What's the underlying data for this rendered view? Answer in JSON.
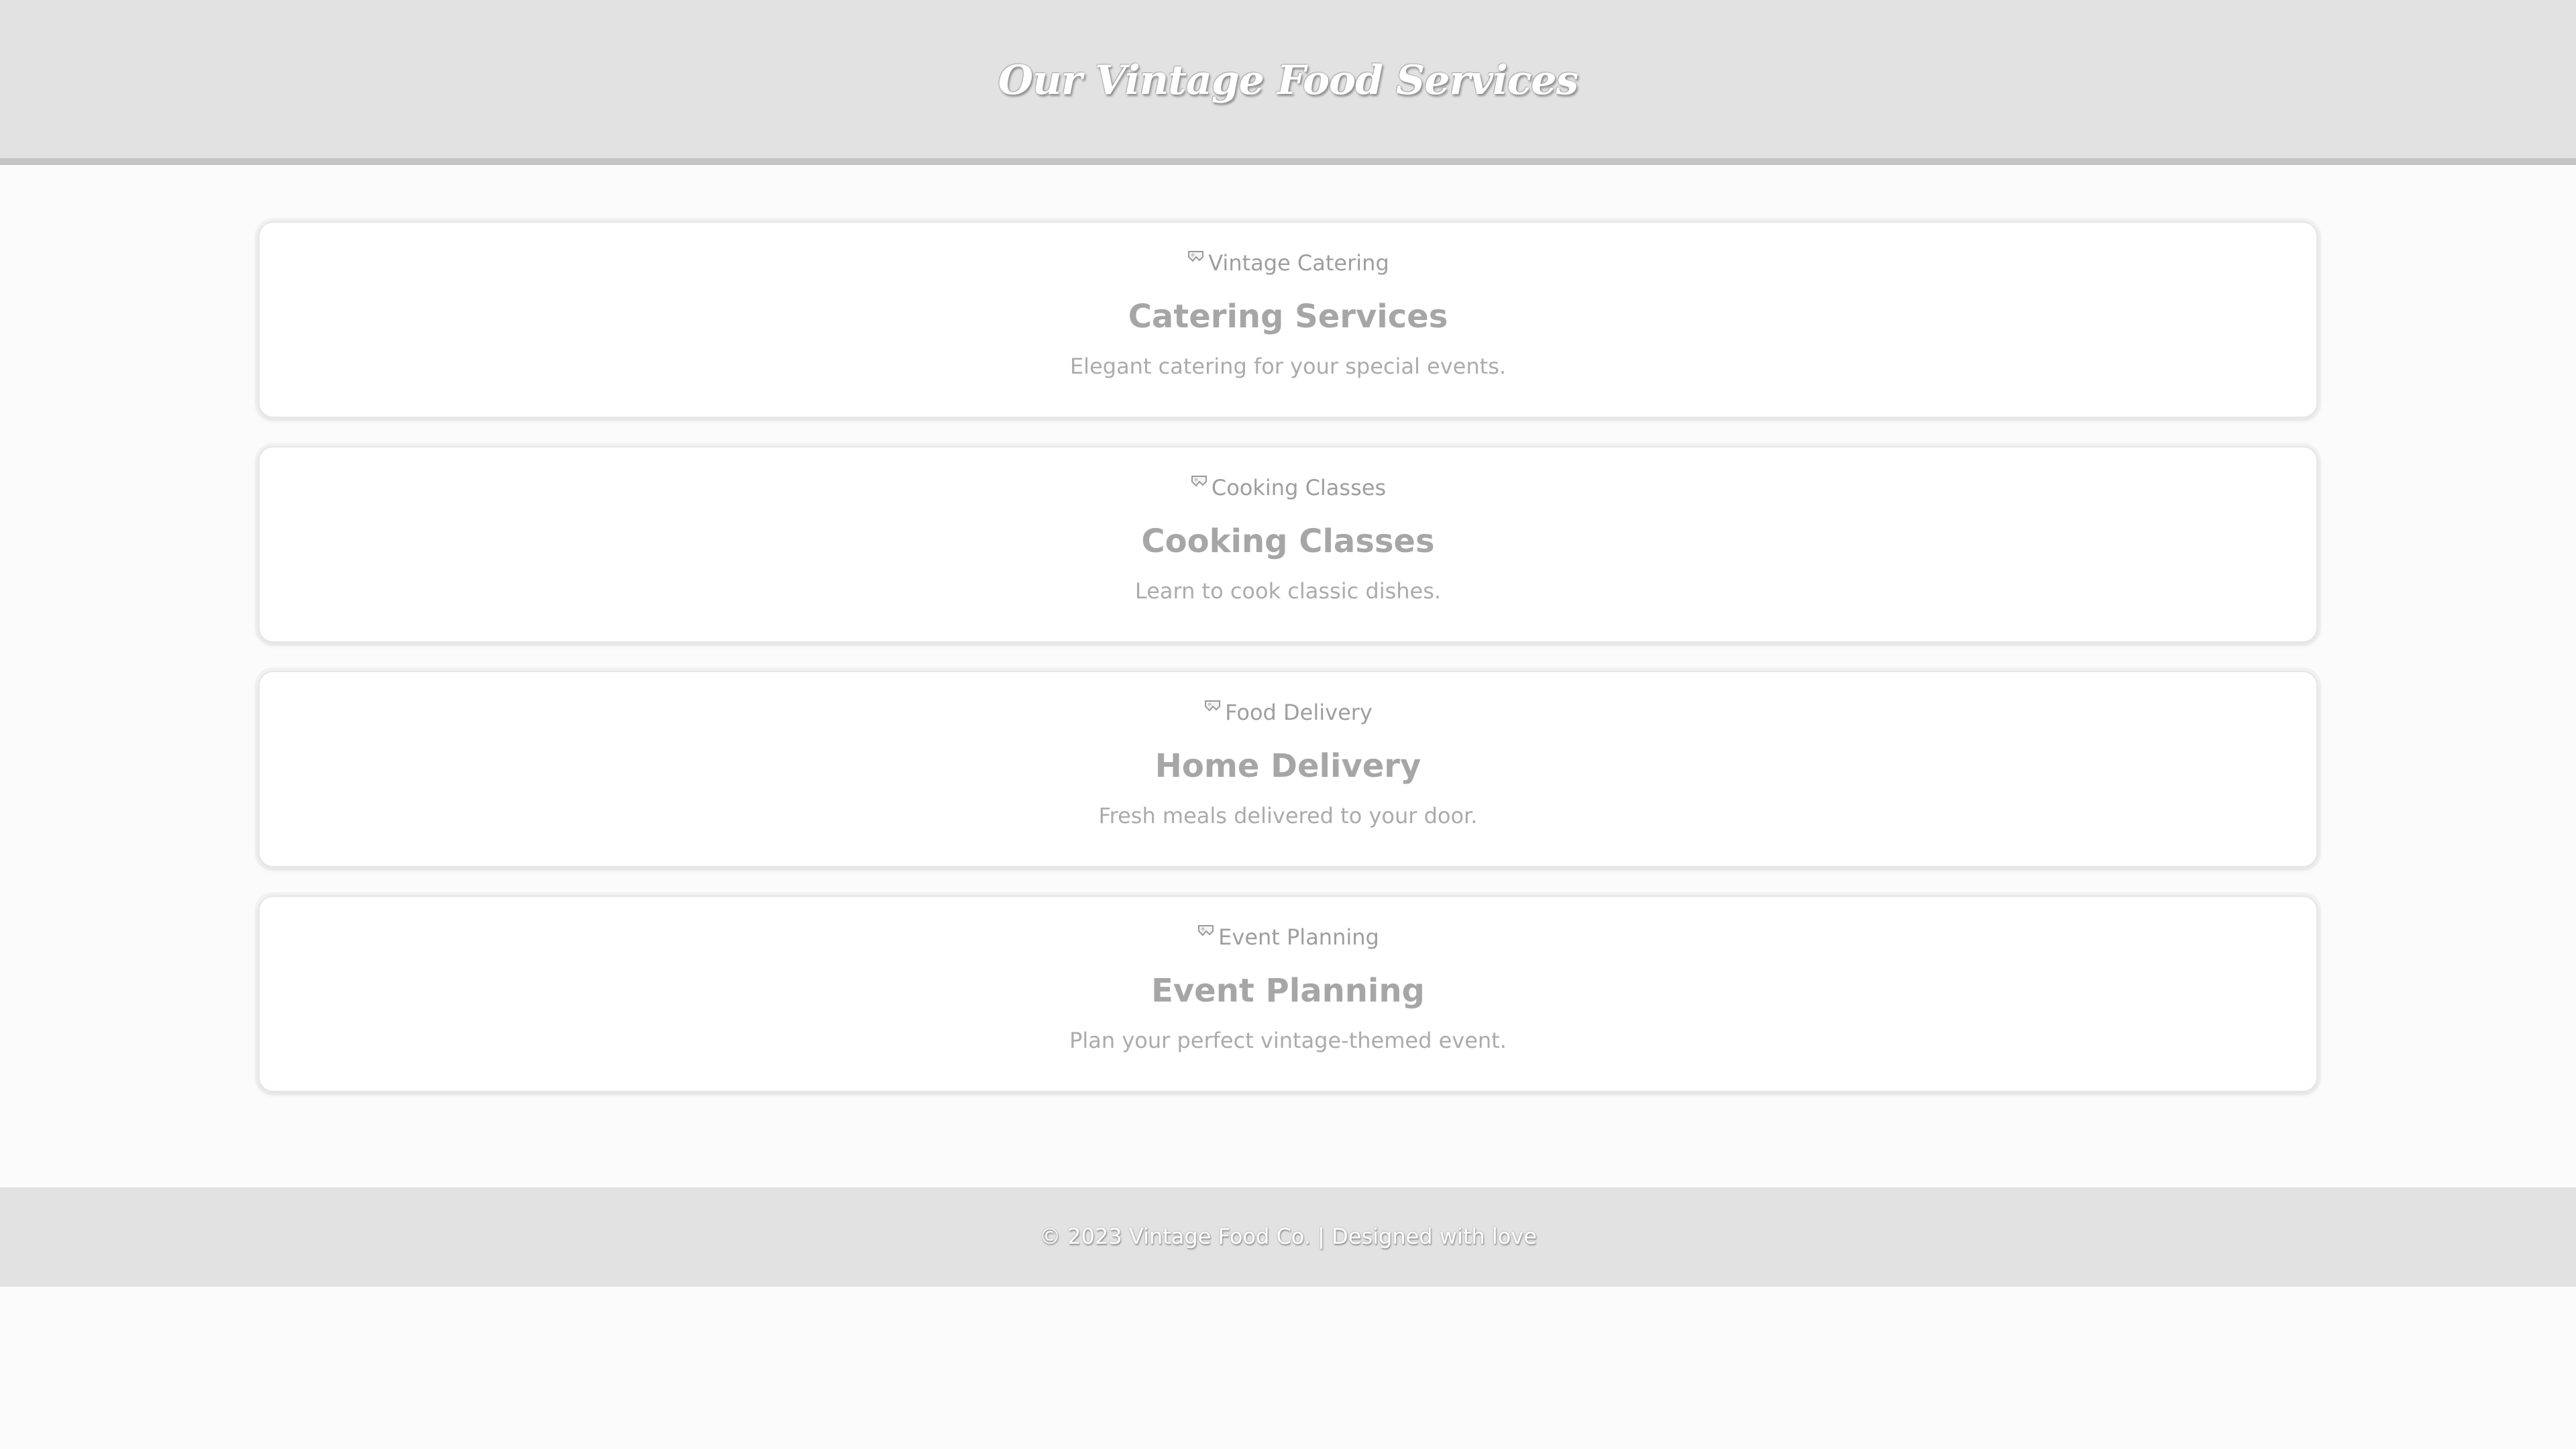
{
  "header": {
    "title": "Our Vintage Food Services"
  },
  "services": [
    {
      "image_alt": "Vintage Catering",
      "title": "Catering Services",
      "description": "Elegant catering for your special events."
    },
    {
      "image_alt": "Cooking Classes",
      "title": "Cooking Classes",
      "description": "Learn to cook classic dishes."
    },
    {
      "image_alt": "Food Delivery",
      "title": "Home Delivery",
      "description": "Fresh meals delivered to your door."
    },
    {
      "image_alt": "Event Planning",
      "title": "Event Planning",
      "description": "Plan your perfect vintage-themed event."
    }
  ],
  "footer": {
    "text": "© 2023 Vintage Food Co. | Designed with love"
  },
  "colors": {
    "header_bg": "#e2e2e2",
    "header_border": "#c4c4c4",
    "page_bg": "#fbfbfb",
    "card_bg": "#ffffff",
    "text_muted": "#a8a8a8"
  },
  "icons": {
    "image_placeholder": "broken-image-icon"
  }
}
